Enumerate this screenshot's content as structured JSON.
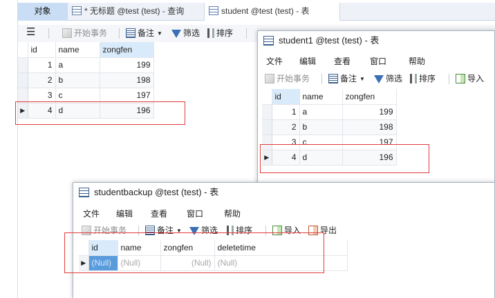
{
  "main": {
    "tabs": [
      {
        "label": "对象"
      },
      {
        "label": "* 无标题 @test (test) - 查询"
      },
      {
        "label": "student @test (test) - 表"
      }
    ],
    "toolbar": {
      "begin_tx": "开始事务",
      "memo": "备注",
      "filter": "筛选",
      "sort": "排序"
    },
    "grid": {
      "columns": [
        "id",
        "name",
        "zongfen"
      ],
      "rows": [
        [
          "1",
          "a",
          "199"
        ],
        [
          "2",
          "b",
          "198"
        ],
        [
          "3",
          "c",
          "197"
        ],
        [
          "4",
          "d",
          "196"
        ]
      ]
    }
  },
  "student1": {
    "title": "student1 @test (test) - 表",
    "menu": [
      "文件",
      "编辑",
      "查看",
      "窗口",
      "帮助"
    ],
    "toolbar": {
      "begin_tx": "开始事务",
      "memo": "备注",
      "filter": "筛选",
      "sort": "排序",
      "import": "导入"
    },
    "grid": {
      "columns": [
        "id",
        "name",
        "zongfen"
      ],
      "rows": [
        [
          "1",
          "a",
          "199"
        ],
        [
          "2",
          "b",
          "198"
        ],
        [
          "3",
          "c",
          "197"
        ],
        [
          "4",
          "d",
          "196"
        ]
      ]
    }
  },
  "backup": {
    "title": "studentbackup @test (test) - 表",
    "menu": [
      "文件",
      "编辑",
      "查看",
      "窗口",
      "帮助"
    ],
    "toolbar": {
      "begin_tx": "开始事务",
      "memo": "备注",
      "filter": "筛选",
      "sort": "排序",
      "import": "导入",
      "export": "导出"
    },
    "grid": {
      "columns": [
        "id",
        "name",
        "zongfen",
        "deletetime"
      ],
      "rows": [
        [
          "(Null)",
          "(Null)",
          "(Null)",
          "(Null)"
        ]
      ]
    }
  },
  "colors": {
    "highlight_box": "#e23b3b",
    "selected_header": "#d9ebfb",
    "selected_cell": "#5a9bdc"
  },
  "icons": {
    "menu": "hamburger-icon",
    "row_pointer": "triangle-right-icon"
  }
}
